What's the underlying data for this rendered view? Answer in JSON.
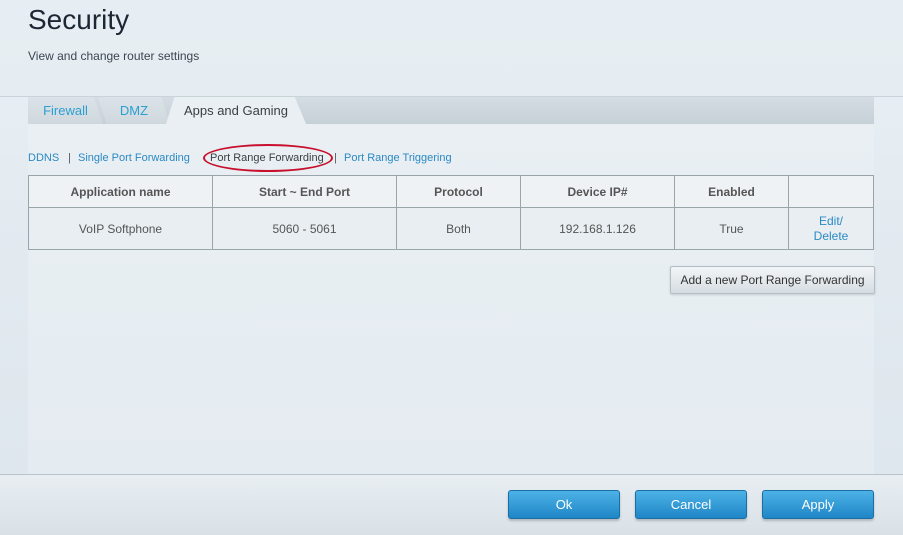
{
  "header": {
    "title": "Security",
    "subtitle": "View and change router settings"
  },
  "tabs": [
    {
      "label": "Firewall",
      "active": false
    },
    {
      "label": "DMZ",
      "active": false
    },
    {
      "label": "Apps and Gaming",
      "active": true
    }
  ],
  "subnav": {
    "items": [
      "DDNS",
      "Single Port Forwarding",
      "Port Range Forwarding",
      "Port Range Triggering"
    ],
    "active": "Port Range Forwarding"
  },
  "table": {
    "columns": [
      "Application name",
      "Start ~ End Port",
      "Protocol",
      "Device IP#",
      "Enabled",
      ""
    ],
    "rows": [
      {
        "application_name": "VoIP Softphone",
        "port_range": "5060 - 5061",
        "protocol": "Both",
        "device_ip": "192.168.1.126",
        "enabled": "True",
        "edit_label": "Edit/",
        "delete_label": "Delete"
      }
    ]
  },
  "add_button_label": "Add a new Port Range Forwarding",
  "footer": {
    "ok_label": "Ok",
    "cancel_label": "Cancel",
    "apply_label": "Apply"
  },
  "colors": {
    "link": "#2b89c4",
    "primary_button": "#2b96d6",
    "highlight_ring": "#c8102e"
  }
}
